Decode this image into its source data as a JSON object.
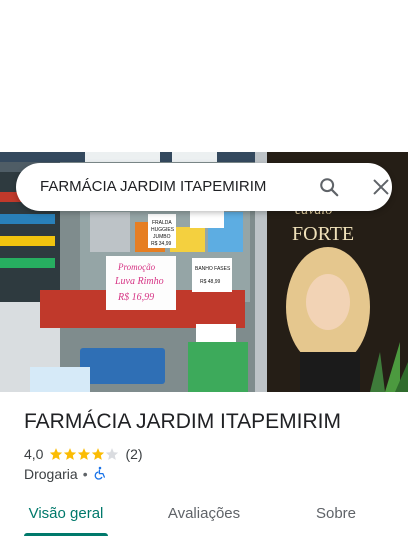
{
  "search": {
    "query": "FARMÁCIA JARDIM ITAPEMIRIM"
  },
  "photo": {
    "signs": {
      "handwritten": "Promoção\nLuva Rimho\nR$ 16,99",
      "fraldas": "FRALDA\nHUGGIES\nJUMBO\nR$ 34,99",
      "banho": "BANHO FASES\nR$ 48,99",
      "brand": "cavalo\nFORTE"
    }
  },
  "place": {
    "title": "FARMÁCIA JARDIM ITAPEMIRIM",
    "rating": "4,0",
    "rating_value": 4.0,
    "reviews": "(2)",
    "category": "Drogaria",
    "separator": "•"
  },
  "tabs": [
    {
      "label": "Visão geral",
      "active": true
    },
    {
      "label": "Avaliações",
      "active": false
    },
    {
      "label": "Sobre",
      "active": false
    }
  ],
  "colors": {
    "accent": "#00796b",
    "star": "#fbbc04",
    "star_empty": "#dadce0",
    "accessibility": "#1a73e8"
  }
}
